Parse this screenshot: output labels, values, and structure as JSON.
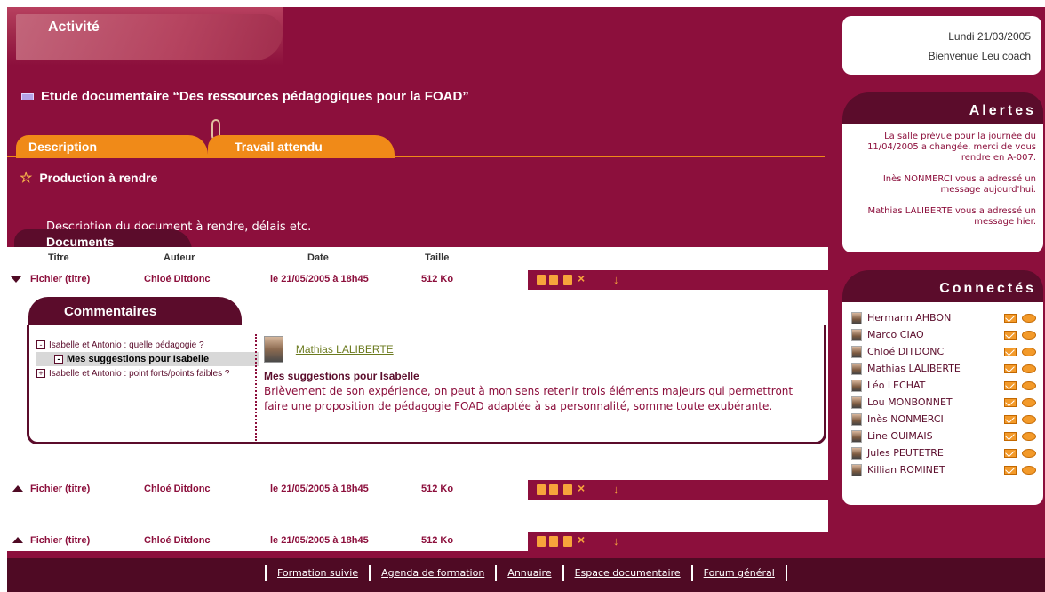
{
  "header": {
    "title": "Activité"
  },
  "study": {
    "title": "Etude documentaire “Des ressources pédagogiques pour la FOAD”"
  },
  "tabs": [
    {
      "label": "Description"
    },
    {
      "label": "Travail attendu"
    }
  ],
  "production": {
    "title": "Production à rendre",
    "description": "Description du document à rendre, délais etc."
  },
  "documents": {
    "tab_label": "Documents",
    "columns": [
      "Titre",
      "Auteur",
      "Date",
      "Taille"
    ],
    "rows": [
      {
        "title": "Fichier (titre)",
        "author": "Chloé Ditdonc",
        "date": "le 21/05/2005 à 18h45",
        "size": "512 Ko"
      },
      {
        "title": "Fichier (titre)",
        "author": "Chloé Ditdonc",
        "date": "le 21/05/2005 à 18h45",
        "size": "512 Ko"
      },
      {
        "title": "Fichier (titre)",
        "author": "Chloé Ditdonc",
        "date": "le 21/05/2005 à 18h45",
        "size": "512 Ko"
      }
    ]
  },
  "comments": {
    "tab_label": "Commentaires",
    "tree": [
      {
        "label": "Isabelle et Antonio : quelle pédagogie ?",
        "box": "-"
      },
      {
        "label": "Mes suggestions pour Isabelle",
        "box": "-"
      },
      {
        "label": "Isabelle et Antonio : point forts/points faibles ?",
        "box": "+"
      }
    ],
    "message": {
      "author": "Mathias LALIBERTE",
      "title": "Mes suggestions pour Isabelle",
      "body": "Brièvement de son expérience, on peut à mon sens retenir trois éléments majeurs qui permettront faire une proposition de pédagogie FOAD adaptée à sa personnalité, somme toute exubérante."
    }
  },
  "date_box": {
    "date": "Lundi 21/03/2005",
    "welcome": "Bienvenue Leu coach"
  },
  "alerts": {
    "title": "Alertes",
    "items": [
      "La salle prévue pour la journée du 11/04/2005 a changée, merci de vous rendre en A-007.",
      "Inès NONMERCI vous a adressé un message aujourd'hui.",
      "Mathias LALIBERTE vous a adressé un message hier."
    ]
  },
  "connected": {
    "title": "Connectés",
    "users": [
      "Hermann AHBON",
      "Marco CIAO",
      "Chloé DITDONC",
      "Mathias LALIBERTE",
      "Léo LECHAT",
      "Lou MONBONNET",
      "Inès NONMERCI",
      "Line OUIMAIS",
      "Jules PEUTETRE",
      "Killian ROMINET"
    ]
  },
  "footer": {
    "links": [
      "Formation suivie",
      "Agenda de formation",
      "Annuaire",
      "Espace documentaire",
      "Forum général"
    ]
  },
  "colors": {
    "primary": "#8c0f3c",
    "dark": "#5b0c2b",
    "accent": "#f08a18"
  }
}
